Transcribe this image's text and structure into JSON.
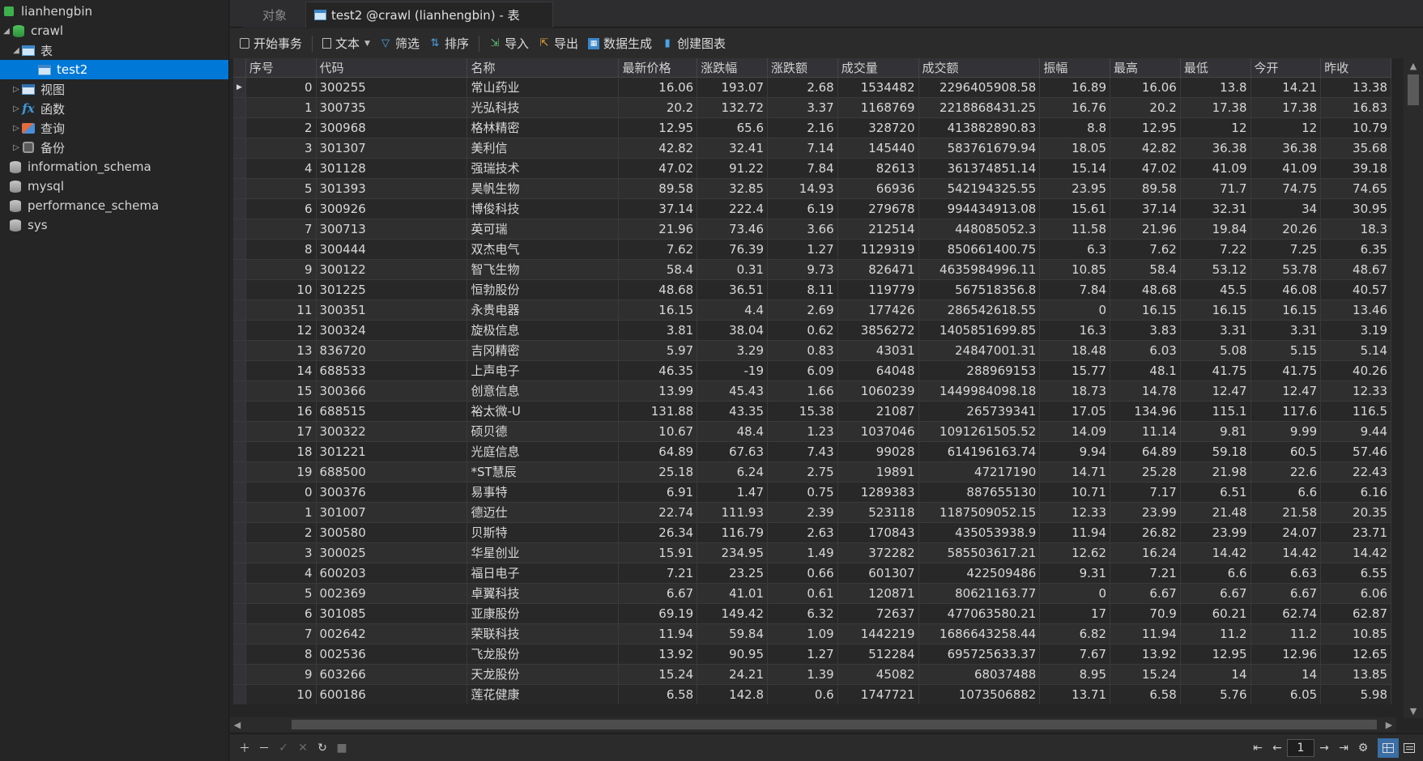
{
  "sidebar": {
    "connection": "lianhengbin",
    "database": "crawl",
    "tables_group": "表",
    "selected_table": "test2",
    "groups": [
      "视图",
      "函数",
      "查询",
      "备份"
    ],
    "other_databases": [
      "information_schema",
      "mysql",
      "performance_schema",
      "sys"
    ]
  },
  "tabs": {
    "objects": "对象",
    "active": "test2 @crawl (lianhengbin) - 表"
  },
  "toolbar": {
    "begin_transaction": "开始事务",
    "text": "文本",
    "filter": "筛选",
    "sort": "排序",
    "import": "导入",
    "export": "导出",
    "generate_data": "数据生成",
    "create_chart": "创建图表"
  },
  "grid": {
    "columns": [
      "序号",
      "代码",
      "名称",
      "最新价格",
      "涨跌幅",
      "涨跌额",
      "成交量",
      "成交额",
      "振幅",
      "最高",
      "最低",
      "今开",
      "昨收"
    ],
    "rows": [
      [
        "0",
        "300255",
        "常山药业",
        "16.06",
        "193.07",
        "2.68",
        "1534482",
        "2296405908.58",
        "16.89",
        "16.06",
        "13.8",
        "14.21",
        "13.38"
      ],
      [
        "1",
        "300735",
        "光弘科技",
        "20.2",
        "132.72",
        "3.37",
        "1168769",
        "2218868431.25",
        "16.76",
        "20.2",
        "17.38",
        "17.38",
        "16.83"
      ],
      [
        "2",
        "300968",
        "格林精密",
        "12.95",
        "65.6",
        "2.16",
        "328720",
        "413882890.83",
        "8.8",
        "12.95",
        "12",
        "12",
        "10.79"
      ],
      [
        "3",
        "301307",
        "美利信",
        "42.82",
        "32.41",
        "7.14",
        "145440",
        "583761679.94",
        "18.05",
        "42.82",
        "36.38",
        "36.38",
        "35.68"
      ],
      [
        "4",
        "301128",
        "强瑞技术",
        "47.02",
        "91.22",
        "7.84",
        "82613",
        "361374851.14",
        "15.14",
        "47.02",
        "41.09",
        "41.09",
        "39.18"
      ],
      [
        "5",
        "301393",
        "昊帆生物",
        "89.58",
        "32.85",
        "14.93",
        "66936",
        "542194325.55",
        "23.95",
        "89.58",
        "71.7",
        "74.75",
        "74.65"
      ],
      [
        "6",
        "300926",
        "博俊科技",
        "37.14",
        "222.4",
        "6.19",
        "279678",
        "994434913.08",
        "15.61",
        "37.14",
        "32.31",
        "34",
        "30.95"
      ],
      [
        "7",
        "300713",
        "英可瑞",
        "21.96",
        "73.46",
        "3.66",
        "212514",
        "448085052.3",
        "11.58",
        "21.96",
        "19.84",
        "20.26",
        "18.3"
      ],
      [
        "8",
        "300444",
        "双杰电气",
        "7.62",
        "76.39",
        "1.27",
        "1129319",
        "850661400.75",
        "6.3",
        "7.62",
        "7.22",
        "7.25",
        "6.35"
      ],
      [
        "9",
        "300122",
        "智飞生物",
        "58.4",
        "0.31",
        "9.73",
        "826471",
        "4635984996.11",
        "10.85",
        "58.4",
        "53.12",
        "53.78",
        "48.67"
      ],
      [
        "10",
        "301225",
        "恒勃股份",
        "48.68",
        "36.51",
        "8.11",
        "119779",
        "567518356.8",
        "7.84",
        "48.68",
        "45.5",
        "46.08",
        "40.57"
      ],
      [
        "11",
        "300351",
        "永贵电器",
        "16.15",
        "4.4",
        "2.69",
        "177426",
        "286542618.55",
        "0",
        "16.15",
        "16.15",
        "16.15",
        "13.46"
      ],
      [
        "12",
        "300324",
        "旋极信息",
        "3.81",
        "38.04",
        "0.62",
        "3856272",
        "1405851699.85",
        "16.3",
        "3.83",
        "3.31",
        "3.31",
        "3.19"
      ],
      [
        "13",
        "836720",
        "吉冈精密",
        "5.97",
        "3.29",
        "0.83",
        "43031",
        "24847001.31",
        "18.48",
        "6.03",
        "5.08",
        "5.15",
        "5.14"
      ],
      [
        "14",
        "688533",
        "上声电子",
        "46.35",
        "-19",
        "6.09",
        "64048",
        "288969153",
        "15.77",
        "48.1",
        "41.75",
        "41.75",
        "40.26"
      ],
      [
        "15",
        "300366",
        "创意信息",
        "13.99",
        "45.43",
        "1.66",
        "1060239",
        "1449984098.18",
        "18.73",
        "14.78",
        "12.47",
        "12.47",
        "12.33"
      ],
      [
        "16",
        "688515",
        "裕太微-U",
        "131.88",
        "43.35",
        "15.38",
        "21087",
        "265739341",
        "17.05",
        "134.96",
        "115.1",
        "117.6",
        "116.5"
      ],
      [
        "17",
        "300322",
        "硕贝德",
        "10.67",
        "48.4",
        "1.23",
        "1037046",
        "1091261505.52",
        "14.09",
        "11.14",
        "9.81",
        "9.99",
        "9.44"
      ],
      [
        "18",
        "301221",
        "光庭信息",
        "64.89",
        "67.63",
        "7.43",
        "99028",
        "614196163.74",
        "9.94",
        "64.89",
        "59.18",
        "60.5",
        "57.46"
      ],
      [
        "19",
        "688500",
        "*ST慧辰",
        "25.18",
        "6.24",
        "2.75",
        "19891",
        "47217190",
        "14.71",
        "25.28",
        "21.98",
        "22.6",
        "22.43"
      ],
      [
        "0",
        "300376",
        "易事特",
        "6.91",
        "1.47",
        "0.75",
        "1289383",
        "887655130",
        "10.71",
        "7.17",
        "6.51",
        "6.6",
        "6.16"
      ],
      [
        "1",
        "301007",
        "德迈仕",
        "22.74",
        "111.93",
        "2.39",
        "523118",
        "1187509052.15",
        "12.33",
        "23.99",
        "21.48",
        "21.58",
        "20.35"
      ],
      [
        "2",
        "300580",
        "贝斯特",
        "26.34",
        "116.79",
        "2.63",
        "170843",
        "435053938.9",
        "11.94",
        "26.82",
        "23.99",
        "24.07",
        "23.71"
      ],
      [
        "3",
        "300025",
        "华星创业",
        "15.91",
        "234.95",
        "1.49",
        "372282",
        "585503617.21",
        "12.62",
        "16.24",
        "14.42",
        "14.42",
        "14.42"
      ],
      [
        "4",
        "600203",
        "福日电子",
        "7.21",
        "23.25",
        "0.66",
        "601307",
        "422509486",
        "9.31",
        "7.21",
        "6.6",
        "6.63",
        "6.55"
      ],
      [
        "5",
        "002369",
        "卓翼科技",
        "6.67",
        "41.01",
        "0.61",
        "120871",
        "80621163.77",
        "0",
        "6.67",
        "6.67",
        "6.67",
        "6.06"
      ],
      [
        "6",
        "301085",
        "亚康股份",
        "69.19",
        "149.42",
        "6.32",
        "72637",
        "477063580.21",
        "17",
        "70.9",
        "60.21",
        "62.74",
        "62.87"
      ],
      [
        "7",
        "002642",
        "荣联科技",
        "11.94",
        "59.84",
        "1.09",
        "1442219",
        "1686643258.44",
        "6.82",
        "11.94",
        "11.2",
        "11.2",
        "10.85"
      ],
      [
        "8",
        "002536",
        "飞龙股份",
        "13.92",
        "90.95",
        "1.27",
        "512284",
        "695725633.37",
        "7.67",
        "13.92",
        "12.95",
        "12.96",
        "12.65"
      ],
      [
        "9",
        "603266",
        "天龙股份",
        "15.24",
        "24.21",
        "1.39",
        "45082",
        "68037488",
        "8.95",
        "15.24",
        "14",
        "14",
        "13.85"
      ],
      [
        "10",
        "600186",
        "莲花健康",
        "6.58",
        "142.8",
        "0.6",
        "1747721",
        "1073506882",
        "13.71",
        "6.58",
        "5.76",
        "6.05",
        "5.98"
      ]
    ]
  },
  "pager": {
    "page": "1"
  }
}
